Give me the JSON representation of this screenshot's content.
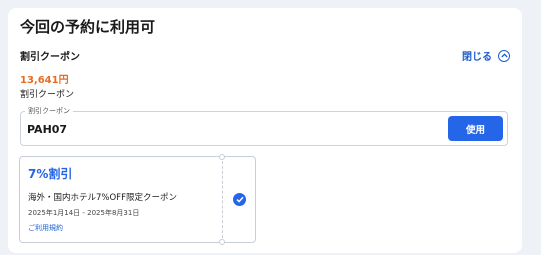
{
  "header": {
    "title": "今回の予約に利用可"
  },
  "discount": {
    "section_label": "割引クーポン",
    "toggle_label": "閉じる",
    "amount": "13,641円",
    "sub_label": "割引クーポン"
  },
  "coupon_input": {
    "legend": "割引クーポン",
    "value": "PAH07",
    "apply_label": "使用"
  },
  "coupon": {
    "title": "7%割引",
    "description": "海外・国内ホテル7%OFF限定クーポン",
    "dates": "2025年1月14日 - 2025年8月31日",
    "terms_label": "ご利用規約",
    "selected": true
  },
  "colors": {
    "accent": "#2566e8",
    "amount": "#e86c1f",
    "link": "#1f5fcf"
  },
  "icons": [
    "chevron-up-icon",
    "check-icon"
  ]
}
